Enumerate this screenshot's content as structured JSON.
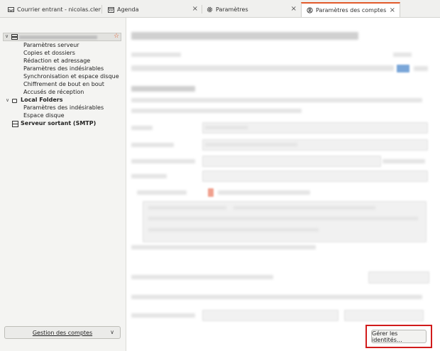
{
  "tabs": [
    {
      "label": "Courrier entrant - nicolas.clement",
      "icon": "inbox-icon",
      "active": false
    },
    {
      "label": "Agenda",
      "icon": "calendar-icon",
      "active": false,
      "close": "×"
    },
    {
      "label": "Paramètres",
      "icon": "gear-icon",
      "active": false,
      "close": "×"
    },
    {
      "label": "Paramètres des comptes",
      "icon": "account-settings-icon",
      "active": true,
      "close": "×"
    }
  ],
  "sidebar": {
    "account_children": [
      "Paramètres serveur",
      "Copies et dossiers",
      "Rédaction et adressage",
      "Paramètres des indésirables",
      "Synchronisation et espace disque",
      "Chiffrement de bout en bout",
      "Accusés de réception"
    ],
    "local_folders": {
      "label": "Local Folders",
      "children": [
        "Paramètres des indésirables",
        "Espace disque"
      ]
    },
    "smtp_label": "Serveur sortant (SMTP)",
    "manage_accounts_label": "Gestion des comptes"
  },
  "main": {
    "manage_identities_label": "Gérer les identités…"
  },
  "colors": {
    "accent": "#e25a2b",
    "highlight_border": "#d11b1b"
  }
}
